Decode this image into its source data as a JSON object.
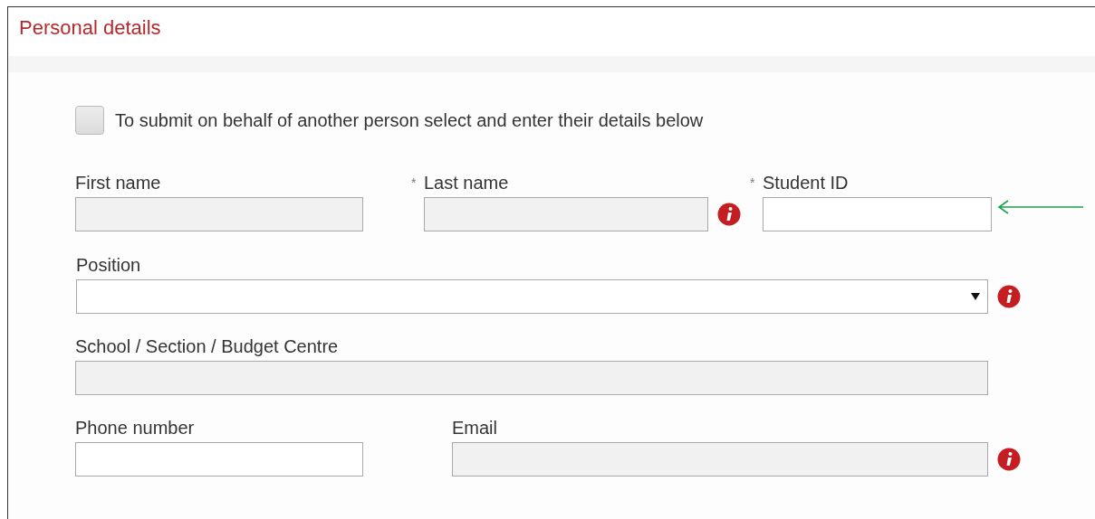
{
  "panel": {
    "title": "Personal details"
  },
  "behalf_checkbox": {
    "label": "To submit on behalf of another person select and enter their details below",
    "checked": false
  },
  "rows": [
    [
      {
        "kind": "text",
        "label": "First name",
        "disabled": true,
        "info": false
      },
      {
        "kind": "text",
        "required_mark": "*",
        "label": "Last name",
        "disabled": true,
        "info": true
      },
      {
        "kind": "text",
        "required_mark": "*",
        "label": "Student ID",
        "disabled": false,
        "info": false
      }
    ],
    [
      {
        "kind": "select",
        "label": "Position",
        "disabled": false,
        "info": true
      }
    ],
    [
      {
        "kind": "text",
        "label": "School / Section / Budget Centre",
        "disabled": true,
        "info": false
      }
    ],
    [
      {
        "kind": "text",
        "label": "Phone number",
        "disabled": false,
        "info": false
      },
      {
        "kind": "text",
        "label": "Email",
        "disabled": true,
        "info": true
      }
    ]
  ]
}
